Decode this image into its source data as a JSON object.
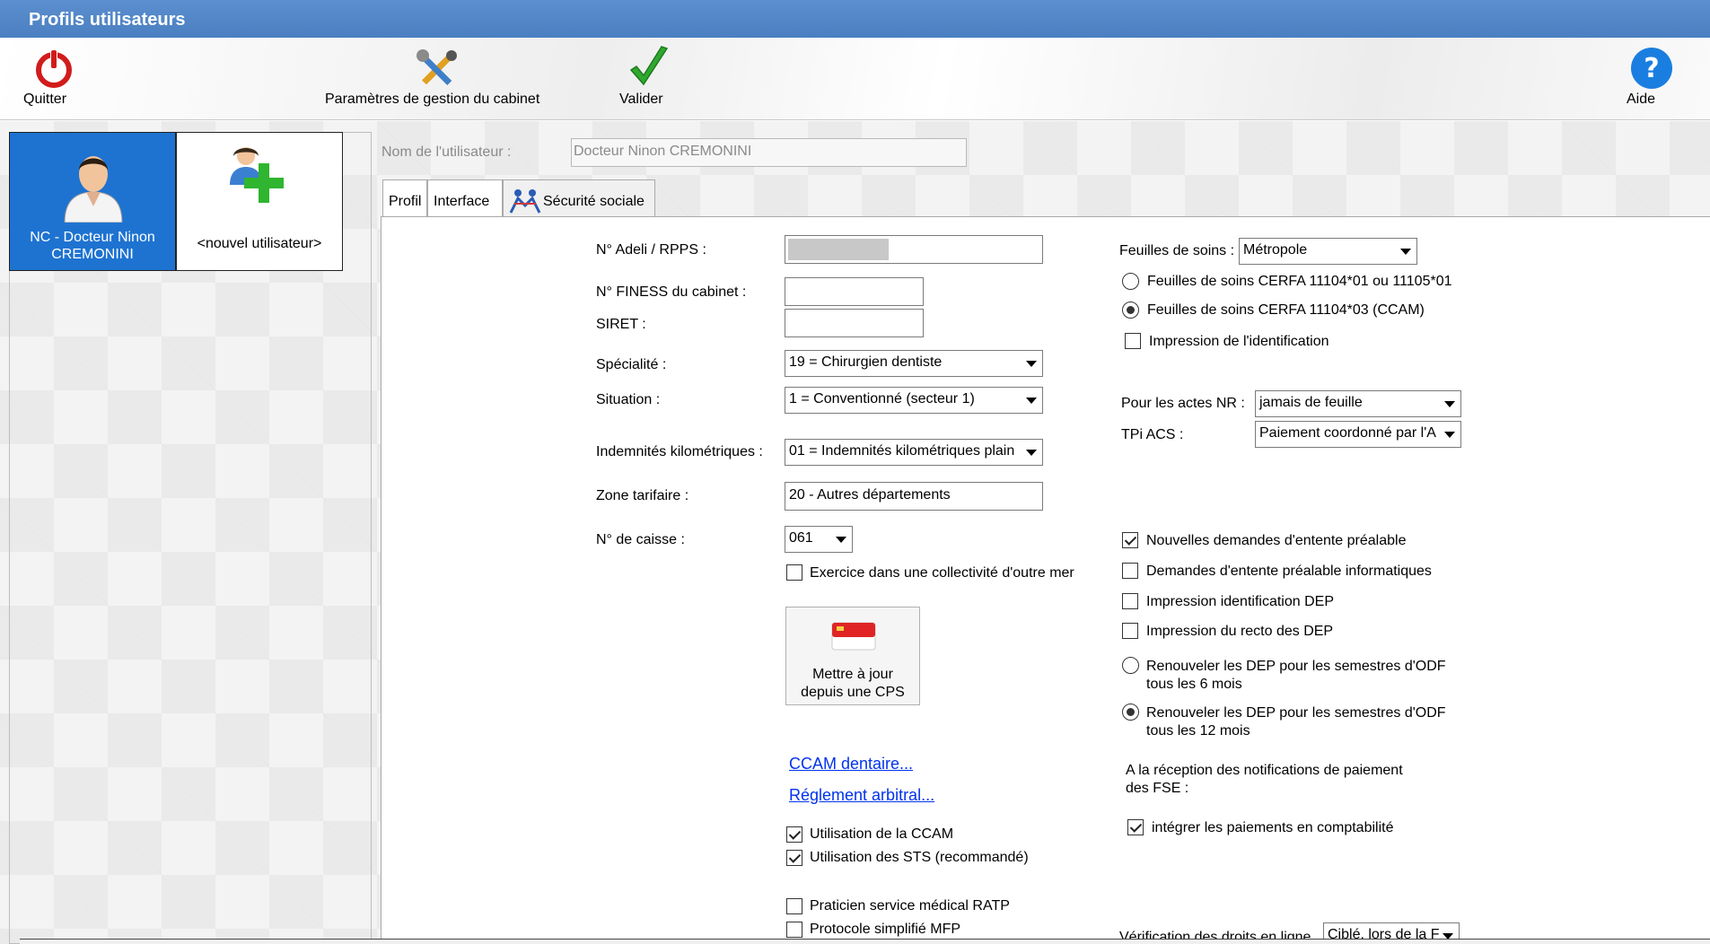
{
  "window": {
    "title": "Profils utilisateurs"
  },
  "toolbar": {
    "quit_label": "Quitter",
    "params_label": "Paramètres de gestion du cabinet",
    "validate_label": "Valider",
    "help_label": "Aide"
  },
  "users": {
    "selected_label": "NC - Docteur Ninon CREMONINI",
    "new_label": "<nouvel utilisateur>"
  },
  "user_name": {
    "label": "Nom de l'utilisateur :",
    "value": "Docteur Ninon CREMONINI"
  },
  "tabs": [
    {
      "label": "Profil"
    },
    {
      "label": "Interface"
    },
    {
      "label": "Sécurité sociale",
      "icon": "social-security-icon"
    }
  ],
  "form": {
    "adeli_label": "N° Adeli / RPPS :",
    "finess_label": "N° FINESS du cabinet :",
    "siret_label": "SIRET :",
    "specialite_label": "Spécialité :",
    "specialite_value": "19 = Chirurgien dentiste",
    "situation_label": "Situation :",
    "situation_value": "1 = Conventionné (secteur 1)",
    "indemnites_label": "Indemnités kilométriques :",
    "indemnites_value": "01 = Indemnités kilométriques plain",
    "zone_label": "Zone tarifaire :",
    "zone_value": "20 - Autres départements",
    "caisse_label": "N° de caisse :",
    "caisse_value": "061",
    "outremer_label": "Exercice dans une collectivité d'outre mer",
    "cps_label_1": "Mettre à jour",
    "cps_label_2": "depuis une CPS",
    "ccam_link": "CCAM dentaire...",
    "reglement_link": "Réglement arbitral...",
    "utilisation_ccam": "Utilisation de la CCAM",
    "utilisation_sts": "Utilisation des STS (recommandé)",
    "ratp": "Praticien service médical RATP",
    "mfp": "Protocole simplifié MFP"
  },
  "right": {
    "feuilles_label": "Feuilles de soins :",
    "feuilles_value": "Métropole",
    "cerfa1": "Feuilles de soins CERFA 11104*01 ou 11105*01",
    "cerfa3": "Feuilles de soins CERFA 11104*03 (CCAM)",
    "impression_ident": "Impression de l'identification",
    "actes_nr_label": "Pour les actes NR :",
    "actes_nr_value": "jamais de feuille",
    "tpi_label": "TPi ACS :",
    "tpi_value": "Paiement coordonné par l'A",
    "nouvelles_demandes": "Nouvelles demandes d'entente préalable",
    "demandes_info": "Demandes d'entente préalable informatiques",
    "impression_dep": "Impression identification DEP",
    "impression_recto": "Impression du recto des DEP",
    "renouveler6_1": "Renouveler les DEP pour les semestres d'ODF",
    "renouveler6_2": "tous les 6 mois",
    "renouveler12_1": "Renouveler les DEP pour les semestres d'ODF",
    "renouveler12_2": "tous les 12 mois",
    "notif_1": "A la réception des notifications de paiement",
    "notif_2": "des FSE :",
    "integrer": "intégrer les paiements en comptabilité",
    "verif_label": "Vérification des droits en ligne",
    "verif_value": "Ciblé, lors de la F"
  },
  "colors": {
    "titlebar": "#4a7fc1",
    "selected_user": "#1e73d1",
    "link": "#0033ee"
  }
}
